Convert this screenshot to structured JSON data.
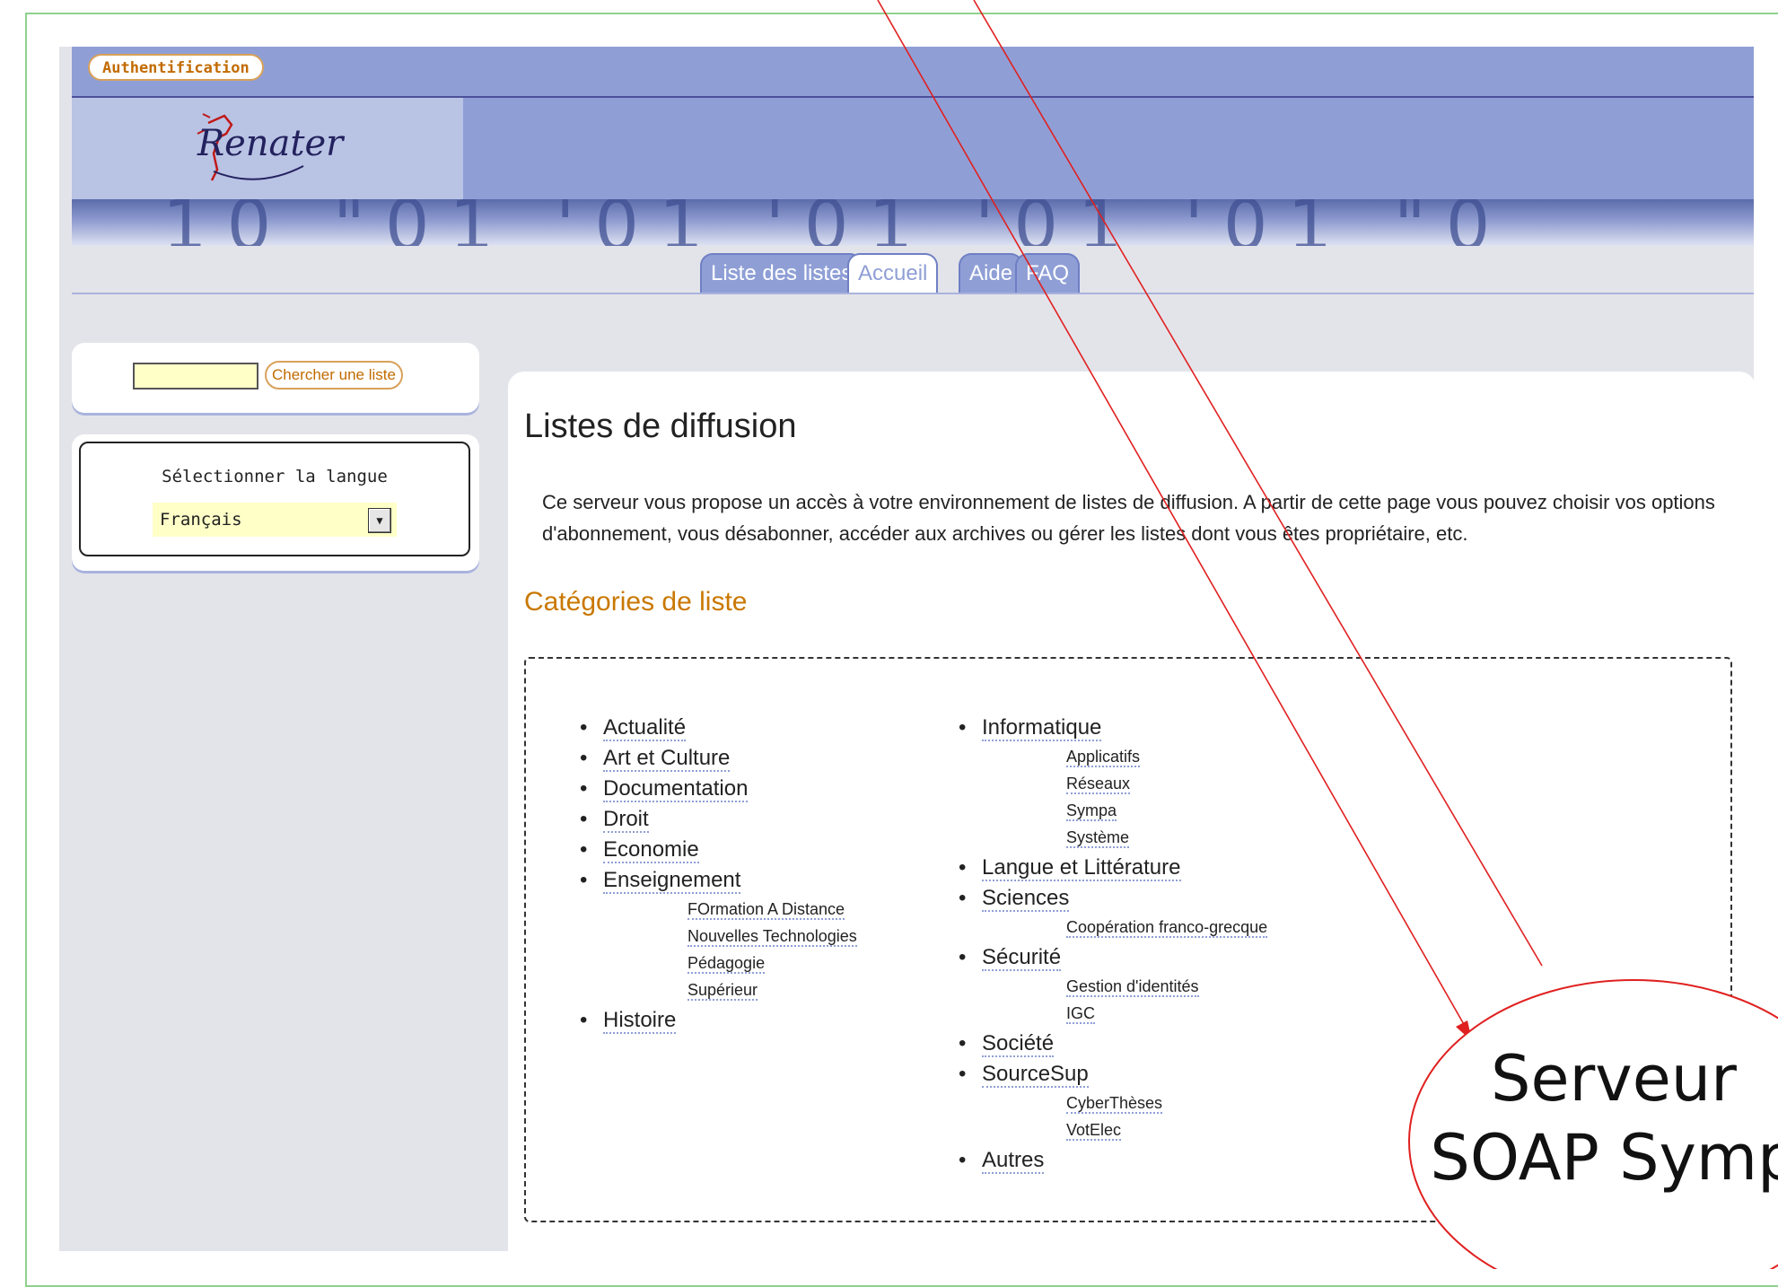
{
  "header": {
    "auth_label": "Authentification",
    "logo_text": "Renater"
  },
  "banner": {
    "pattern_text": "_10  \"01  '01  '01  '01  '01  \"0"
  },
  "tabs": [
    {
      "label": "Liste des listes",
      "active": false
    },
    {
      "label": "Accueil",
      "active": true
    },
    {
      "label": "Aide",
      "active": false
    },
    {
      "label": "FAQ",
      "active": false
    }
  ],
  "sidebar": {
    "search_value": "",
    "search_button": "Chercher une liste",
    "lang_label": "Sélectionner la langue",
    "lang_selected": "Français"
  },
  "main": {
    "title": "Listes de diffusion",
    "intro": "Ce serveur vous propose un accès à votre environnement de listes de diffusion. A partir de cette page vous pouvez choisir vos options d'abonnement, vous désabonner, accéder aux archives ou gérer les listes dont vous êtes propriétaire, etc.",
    "categories_title": "Catégories de liste"
  },
  "categories_left": [
    {
      "label": "Actualité",
      "subs": []
    },
    {
      "label": "Art et Culture",
      "subs": []
    },
    {
      "label": "Documentation",
      "subs": []
    },
    {
      "label": "Droit",
      "subs": []
    },
    {
      "label": "Economie",
      "subs": []
    },
    {
      "label": "Enseignement",
      "subs": [
        "FOrmation A Distance",
        "Nouvelles Technologies",
        "Pédagogie",
        "Supérieur"
      ]
    },
    {
      "label": "Histoire",
      "subs": []
    }
  ],
  "categories_right": [
    {
      "label": "Informatique",
      "subs": [
        "Applicatifs",
        "Réseaux",
        "Sympa",
        "Système"
      ]
    },
    {
      "label": "Langue et Littérature",
      "subs": []
    },
    {
      "label": "Sciences",
      "subs": [
        "Coopération franco-grecque"
      ]
    },
    {
      "label": "Sécurité",
      "subs": [
        "Gestion d'identités",
        "IGC"
      ]
    },
    {
      "label": "Société",
      "subs": []
    },
    {
      "label": "SourceSup",
      "subs": [
        "CyberThèses",
        "VotElec"
      ]
    },
    {
      "label": "Autres",
      "subs": []
    }
  ],
  "annotation": {
    "line1": "Serveur",
    "line2": "SOAP Symp"
  },
  "colors": {
    "accent": "#8f9fd6",
    "orange": "#c97800",
    "annotation": "#e02020",
    "frame": "#8fd18f"
  }
}
